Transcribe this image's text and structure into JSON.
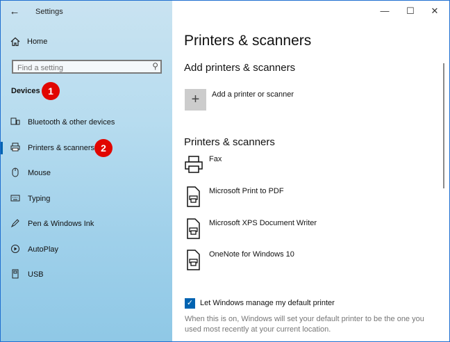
{
  "window": {
    "title": "Settings",
    "back_icon": "arrow-left-icon",
    "controls": [
      "minimize",
      "maximize",
      "close"
    ]
  },
  "sidebar": {
    "home_label": "Home",
    "search_placeholder": "Find a setting",
    "section_title": "Devices",
    "items": [
      {
        "label": "Bluetooth & other devices",
        "icon": "bluetooth-devices-icon"
      },
      {
        "label": "Printers & scanners",
        "icon": "printer-icon",
        "selected": true
      },
      {
        "label": "Mouse",
        "icon": "mouse-icon"
      },
      {
        "label": "Typing",
        "icon": "keyboard-icon"
      },
      {
        "label": "Pen & Windows Ink",
        "icon": "pen-icon"
      },
      {
        "label": "AutoPlay",
        "icon": "autoplay-icon"
      },
      {
        "label": "USB",
        "icon": "usb-icon"
      }
    ]
  },
  "annotations": {
    "badge1": "1",
    "badge2": "2",
    "color": "#e10600"
  },
  "main": {
    "title": "Printers & scanners",
    "add_section_title": "Add printers & scanners",
    "add_label": "Add a printer or scanner",
    "list_section_title": "Printers & scanners",
    "printers": [
      {
        "name": "Fax",
        "icon": "fax-icon"
      },
      {
        "name": "Microsoft Print to PDF",
        "icon": "printer-doc-icon"
      },
      {
        "name": "Microsoft XPS Document Writer",
        "icon": "printer-doc-icon"
      },
      {
        "name": "OneNote for Windows 10",
        "icon": "printer-doc-icon"
      }
    ],
    "default_checkbox_label": "Let Windows manage my default printer",
    "default_checkbox_checked": true,
    "default_description": "When this is on, Windows will set your default printer to be the one you used most recently at your current location."
  },
  "colors": {
    "accent": "#0063b1",
    "sidebar": "#b7dcef"
  }
}
